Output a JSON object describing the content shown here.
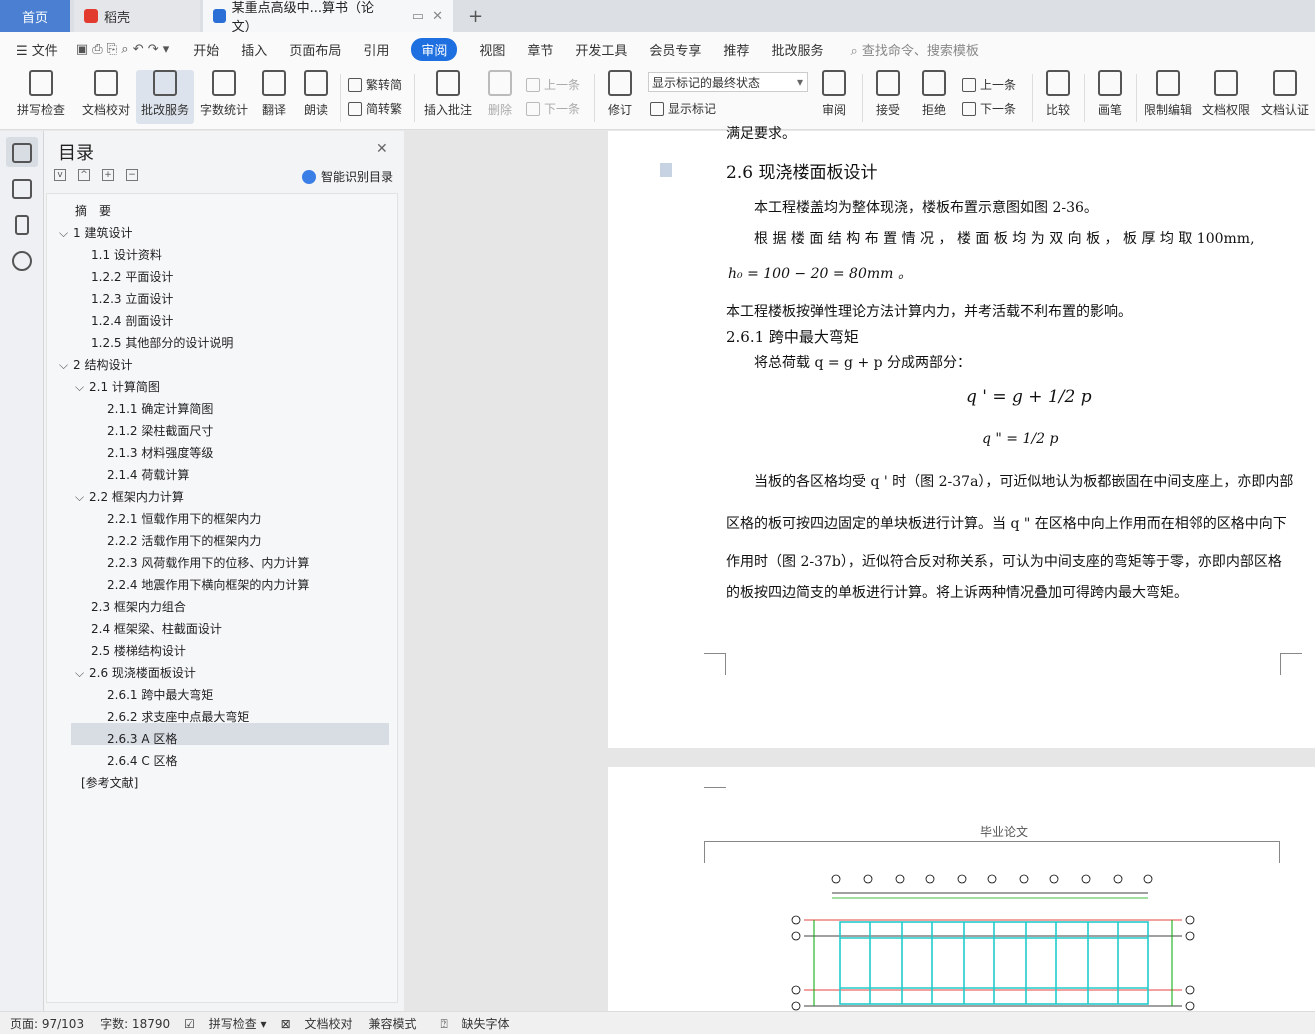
{
  "tabs": {
    "home": "首页",
    "daoke": "稻壳",
    "doc": "某重点高级中...算书（论文）",
    "new_tab": "+"
  },
  "menu": {
    "file": "文件",
    "items": [
      "开始",
      "插入",
      "页面布局",
      "引用",
      "审阅",
      "视图",
      "章节",
      "开发工具",
      "会员专享",
      "推荐",
      "批改服务"
    ],
    "active": "审阅",
    "search": "查找命令、搜索模板"
  },
  "ribbon": {
    "spell": "拼写检查",
    "proof": "文档校对",
    "correct": "批改服务",
    "wordcount": "字数统计",
    "translate": "翻译",
    "read": "朗读",
    "trad": "繁转简",
    "simp": "简转繁",
    "insert_comment": "插入批注",
    "delete": "删除",
    "prev": "上一条",
    "next": "下一条",
    "revise": "修订",
    "show_state": "显示标记的最终状态",
    "show_mark": "显示标记",
    "review": "审阅",
    "accept": "接受",
    "reject": "拒绝",
    "prev2": "上一条",
    "next2": "下一条",
    "compare": "比较",
    "pen": "画笔",
    "restrict": "限制编辑",
    "perm": "文档权限",
    "auth": "文档认证"
  },
  "toc": {
    "title": "目录",
    "smart": "智能识别目录",
    "items": [
      {
        "text": "摘　要",
        "level": 0,
        "chev": ""
      },
      {
        "text": "1  建筑设计",
        "level": 0,
        "chev": "v"
      },
      {
        "text": "1.1  设计资料",
        "level": 1,
        "chev": ""
      },
      {
        "text": "1.2.2  平面设计",
        "level": 1,
        "chev": ""
      },
      {
        "text": "1.2.3  立面设计",
        "level": 1,
        "chev": ""
      },
      {
        "text": "1.2.4  剖面设计",
        "level": 1,
        "chev": ""
      },
      {
        "text": "1.2.5  其他部分的设计说明",
        "level": 1,
        "chev": ""
      },
      {
        "text": "2  结构设计",
        "level": 0,
        "chev": "v"
      },
      {
        "text": "2.1  计算简图",
        "level": 1,
        "chev": "v"
      },
      {
        "text": "2.1.1  确定计算简图",
        "level": 2,
        "chev": ""
      },
      {
        "text": "2.1.2  梁柱截面尺寸",
        "level": 2,
        "chev": ""
      },
      {
        "text": "2.1.3  材料强度等级",
        "level": 2,
        "chev": ""
      },
      {
        "text": "2.1.4  荷载计算",
        "level": 2,
        "chev": ""
      },
      {
        "text": "2.2  框架内力计算",
        "level": 1,
        "chev": "v"
      },
      {
        "text": "2.2.1  恒载作用下的框架内力",
        "level": 2,
        "chev": ""
      },
      {
        "text": "2.2.2  活载作用下的框架内力",
        "level": 2,
        "chev": ""
      },
      {
        "text": "2.2.3  风荷载作用下的位移、内力计算",
        "level": 2,
        "chev": ""
      },
      {
        "text": "2.2.4  地震作用下横向框架的内力计算",
        "level": 2,
        "chev": ""
      },
      {
        "text": "2.3  框架内力组合",
        "level": 1,
        "chev": ""
      },
      {
        "text": "2.4  框架梁、柱截面设计",
        "level": 1,
        "chev": ""
      },
      {
        "text": "2.5  楼梯结构设计",
        "level": 1,
        "chev": ""
      },
      {
        "text": "2.6  现浇楼面板设计",
        "level": 1,
        "chev": "v"
      },
      {
        "text": "2.6.1  跨中最大弯矩",
        "level": 2,
        "chev": ""
      },
      {
        "text": "2.6.2  求支座中点最大弯矩",
        "level": 2,
        "chev": ""
      },
      {
        "text": "2.6.3 A 区格",
        "level": 2,
        "chev": ""
      },
      {
        "text": "2.6.4 C 区格",
        "level": 2,
        "chev": ""
      },
      {
        "text": "[参考文献]",
        "level": 0,
        "chev": ""
      }
    ]
  },
  "doc": {
    "top_frag": "满足要求。",
    "h26": "2.6  现浇楼面板设计",
    "p1": "本工程楼盖均为整体现浇，楼板布置示意图如图 2-36。",
    "p2": "根 据 楼 面 结 构 布 置 情 况 ， 楼 面 板 均 为 双 向 板 ， 板 厚 均 取  100mm,",
    "p3": "h₀ = 100 − 20 = 80mm 。",
    "p4": "本工程楼板按弹性理论方法计算内力，并考活载不利布置的影响。",
    "h261": "2.6.1  跨中最大弯矩",
    "p5": "将总荷载 q = g + p 分成两部分：",
    "eq1": "q ' = g + 1/2 p",
    "eq2": "q \" = 1/2 p",
    "p6": "当板的各区格均受 q ' 时（图 2-37a），可近似地认为板都嵌固在中间支座上，亦即内部",
    "p7": "区格的板可按四边固定的单块板进行计算。当 q \" 在区格中向上作用而在相邻的区格中向下",
    "p8": "作用时（图 2-37b），近似符合反对称关系，可认为中间支座的弯矩等于零，亦即内部区格",
    "p9": "的板按四边简支的单板进行计算。将上诉两种情况叠加可得跨内最大弯矩。",
    "header2": "毕业论文"
  },
  "status": {
    "page": "页面: 97/103",
    "words": "字数: 18790",
    "spell": "拼写检查",
    "proof": "文档校对",
    "compat": "兼容模式",
    "missing_font": "缺失字体"
  }
}
